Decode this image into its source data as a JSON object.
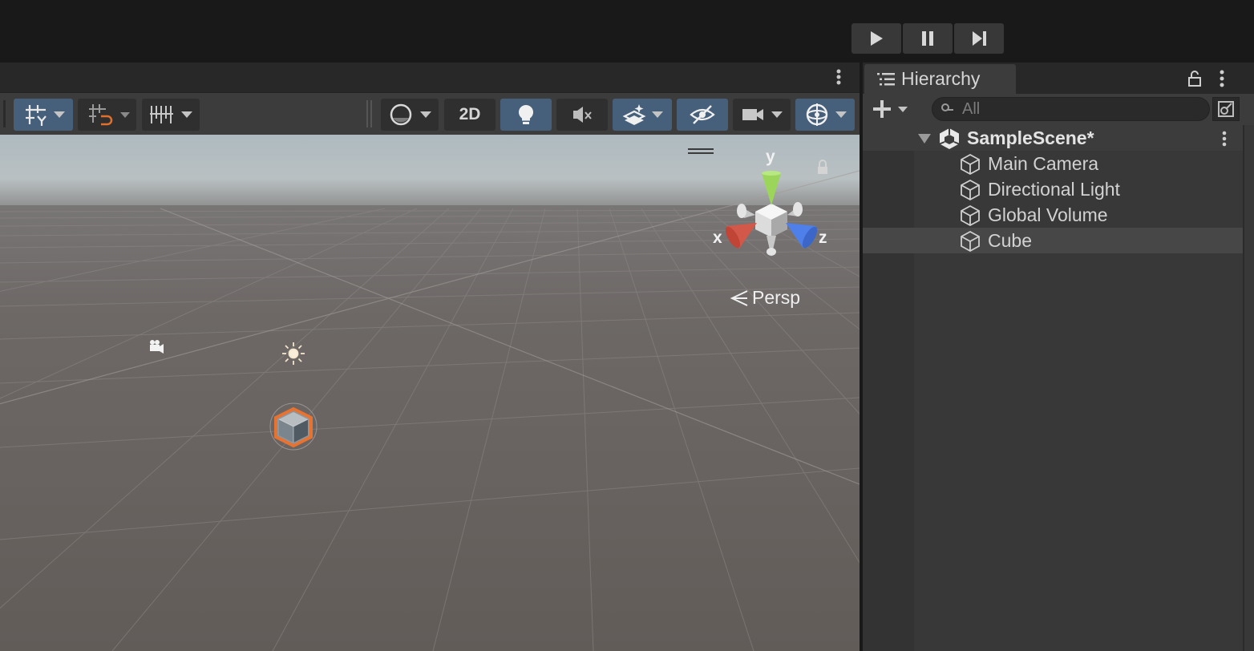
{
  "colors": {
    "accent": "#46607c",
    "selection_orange": "#e8722f",
    "axis_x": "#d2584a",
    "axis_y": "#9bd65a",
    "axis_z": "#4f7fe8"
  },
  "playbar": {
    "play_icon": "play-icon",
    "pause_icon": "pause-icon",
    "step_icon": "step-icon"
  },
  "scene_toolbar": {
    "mode_2d_label": "2D",
    "icons": [
      "grid-snap-icon",
      "snap-increment-icon",
      "ruler-icon",
      "shading-mode-icon",
      "lighting-icon",
      "audio-mute-icon",
      "effects-icon",
      "hidden-objects-icon",
      "camera-icon",
      "gizmos-icon"
    ]
  },
  "viewport": {
    "gizmo": {
      "y_label": "y",
      "x_label": "x",
      "z_label": "z"
    },
    "projection_label": "Persp"
  },
  "hierarchy": {
    "tab_label": "Hierarchy",
    "search_placeholder": "All",
    "scene_name": "SampleScene*",
    "items": [
      {
        "label": "Main Camera"
      },
      {
        "label": "Directional Light"
      },
      {
        "label": "Global Volume"
      },
      {
        "label": "Cube"
      }
    ]
  }
}
